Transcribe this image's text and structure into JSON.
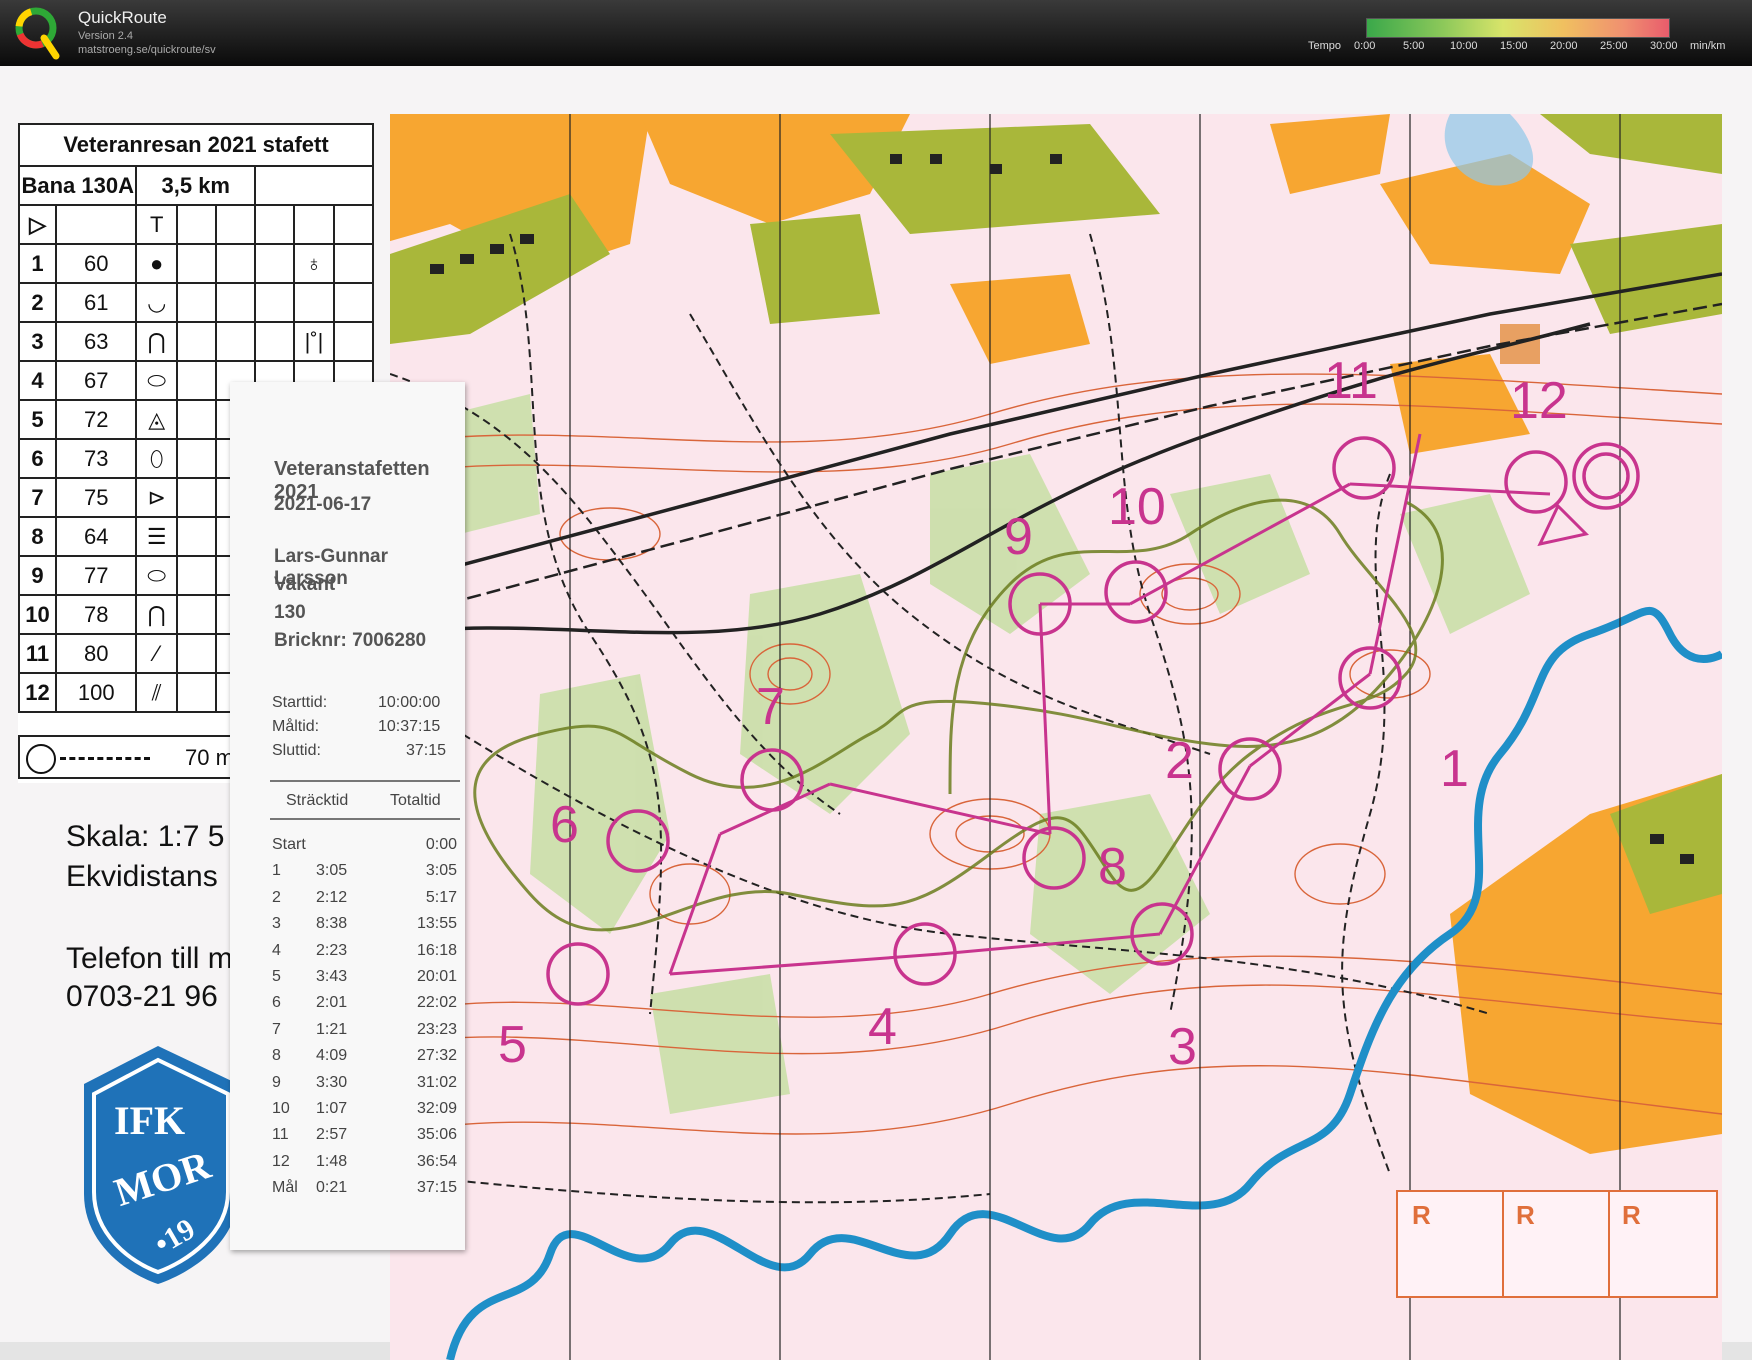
{
  "header": {
    "app_name": "QuickRoute",
    "version": "Version 2.4",
    "url": "matstroeng.se/quickroute/sv",
    "tempo_label": "Tempo",
    "tempo_ticks": [
      "0:00",
      "5:00",
      "10:00",
      "15:00",
      "20:00",
      "25:00",
      "30:00"
    ],
    "tempo_unit": "min/km"
  },
  "colors": {
    "course": "#c8348e",
    "contour": "#d9653a",
    "forest_open": "#f7a631",
    "green": "#b9d68f",
    "water": "#3aa6d8"
  },
  "description_sheet": {
    "title": "Veteranresan 2021 stafett",
    "course": "Bana 130A",
    "length": "3,5 km",
    "start_symbol": "▷",
    "start_feature": "T",
    "controls": [
      {
        "num": "1",
        "code": "60",
        "sym": "●",
        "extra": "♁"
      },
      {
        "num": "2",
        "code": "61",
        "sym": "◡",
        "extra": ""
      },
      {
        "num": "3",
        "code": "63",
        "sym": "⋂",
        "extra": "|˚|"
      },
      {
        "num": "4",
        "code": "67",
        "sym": "⬭",
        "extra": ""
      },
      {
        "num": "5",
        "code": "72",
        "sym": "◬",
        "extra": ""
      },
      {
        "num": "6",
        "code": "73",
        "sym": "⬯",
        "extra": ""
      },
      {
        "num": "7",
        "code": "75",
        "sym": "⊳",
        "extra": ""
      },
      {
        "num": "8",
        "code": "64",
        "sym": "☰",
        "extra": "⁘"
      },
      {
        "num": "9",
        "code": "77",
        "sym": "⬭",
        "extra": ""
      },
      {
        "num": "10",
        "code": "78",
        "sym": "⋂",
        "extra": ""
      },
      {
        "num": "11",
        "code": "80",
        "sym": "⁄",
        "extra": ""
      },
      {
        "num": "12",
        "code": "100",
        "sym": "⫽",
        "extra": ""
      }
    ],
    "finish_distance": "70 m"
  },
  "map_info": {
    "scale": "Skala: 1:7 5",
    "ekvidistans": "Ekvidistans",
    "phone_label": "Telefon till m",
    "phone": "0703-21 96"
  },
  "club": {
    "line1": "IFK",
    "line2": "MOR",
    "year": "•19"
  },
  "receipt": {
    "event": "Veteranstafetten 2021",
    "date": "2021-06-17",
    "runner": "Lars-Gunnar Larsson",
    "club": "Vakant",
    "class": "130",
    "bricknr": "Bricknr: 7006280",
    "starttid_label": "Starttid:",
    "starttid": "10:00:00",
    "maltid_label": "Måltid:",
    "maltid": "10:37:15",
    "sluttid_label": "Sluttid:",
    "sluttid": "37:15",
    "col_split": "Sträcktid",
    "col_total": "Totaltid",
    "splits": [
      {
        "leg": "Start",
        "split": "",
        "total": "0:00"
      },
      {
        "leg": "1",
        "split": "3:05",
        "total": "3:05"
      },
      {
        "leg": "2",
        "split": "2:12",
        "total": "5:17"
      },
      {
        "leg": "3",
        "split": "8:38",
        "total": "13:55"
      },
      {
        "leg": "4",
        "split": "2:23",
        "total": "16:18"
      },
      {
        "leg": "5",
        "split": "3:43",
        "total": "20:01"
      },
      {
        "leg": "6",
        "split": "2:01",
        "total": "22:02"
      },
      {
        "leg": "7",
        "split": "1:21",
        "total": "23:23"
      },
      {
        "leg": "8",
        "split": "4:09",
        "total": "27:32"
      },
      {
        "leg": "9",
        "split": "3:30",
        "total": "31:02"
      },
      {
        "leg": "10",
        "split": "1:07",
        "total": "32:09"
      },
      {
        "leg": "11",
        "split": "2:57",
        "total": "35:06"
      },
      {
        "leg": "12",
        "split": "1:48",
        "total": "36:54"
      },
      {
        "leg": "Mål",
        "split": "0:21",
        "total": "37:15"
      }
    ]
  },
  "control_labels": [
    "1",
    "2",
    "3",
    "4",
    "5",
    "6",
    "7",
    "8",
    "9",
    "10",
    "11",
    "12"
  ],
  "r_boxes": [
    "R",
    "R",
    "R"
  ]
}
